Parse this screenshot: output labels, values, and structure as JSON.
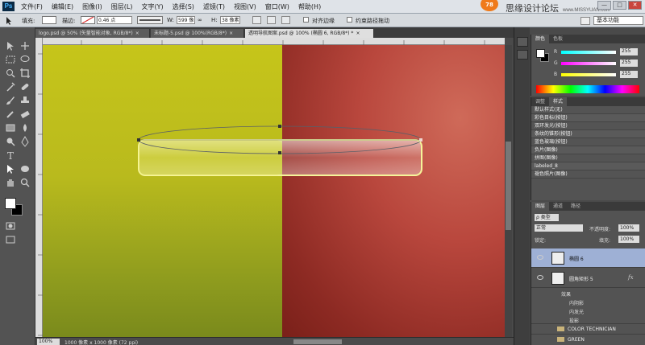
{
  "app": {
    "logo": "Ps",
    "menu": [
      "文件(F)",
      "编辑(E)",
      "图像(I)",
      "图层(L)",
      "文字(Y)",
      "选择(S)",
      "滤镜(T)",
      "视图(V)",
      "窗口(W)",
      "帮助(H)"
    ],
    "badge": "78",
    "site_name": "思缘设计论坛",
    "site_url": "www.MISSYUAN.com",
    "window_buttons": [
      "—",
      "□",
      "✕"
    ]
  },
  "options": {
    "fill_label": "填充:",
    "stroke_label": "描边:",
    "stroke_width": "0.46 点",
    "w_label": "W:",
    "w_value": "599 像",
    "link": "∞",
    "h_label": "H:",
    "h_value": "38 像素",
    "align_edges": "对齐边缘",
    "constrain": "约束路径拖动",
    "workspace": "基本功能"
  },
  "tabs": [
    {
      "label": "logo.psd @ 50% (矢量智能对象, RGB/8*)",
      "close": "×"
    },
    {
      "label": "未标题-5.psd @ 100%(RGB/8*)",
      "close": "×"
    },
    {
      "label": "透明导航图案.psd @ 100% (椭圆 6, RGB/8*) *",
      "close": "×"
    }
  ],
  "status": {
    "zoom": "100%",
    "doc_info": "1000 像素 x 1000 像素 (72 ppi)"
  },
  "color_panel": {
    "tabs": [
      "颜色",
      "色板"
    ],
    "channels": [
      {
        "label": "R",
        "value": "255"
      },
      {
        "label": "G",
        "value": "255"
      },
      {
        "label": "B",
        "value": "255"
      }
    ]
  },
  "styles_panel": {
    "tabs": [
      "调整",
      "样式"
    ],
    "items": [
      "默认样式(无)",
      "彩色目标(按钮)",
      "双环发光(按钮)",
      "条纹的锥形(按钮)",
      "蓝色玻璃(按钮)",
      "负片(图像)",
      "拼图(图像)",
      "labeled_8",
      "褪色照片(图像)"
    ]
  },
  "layers_panel": {
    "tabs": [
      "图层",
      "通道",
      "路径"
    ],
    "filter": "ρ 类型",
    "mode": "正常",
    "opacity_label": "不透明度:",
    "opacity": "100%",
    "lock_label": "锁定:",
    "fill_label": "填充:",
    "fill": "100%",
    "layers": [
      {
        "name": "椭圆 6",
        "active": true
      },
      {
        "name": "圆角矩形 5",
        "active": false,
        "fx": "fx"
      }
    ],
    "effects_label": "效果",
    "effects": [
      "内阴影",
      "内发光",
      "投影"
    ],
    "groups": [
      "COLOR TECHNICIAN",
      "GREEN"
    ]
  },
  "colors": {
    "canvas_left": "#c6c51a",
    "canvas_right": "#b9473d",
    "accent_badge": "#ef7a1a",
    "layer_selected": "#9eb0d5"
  }
}
